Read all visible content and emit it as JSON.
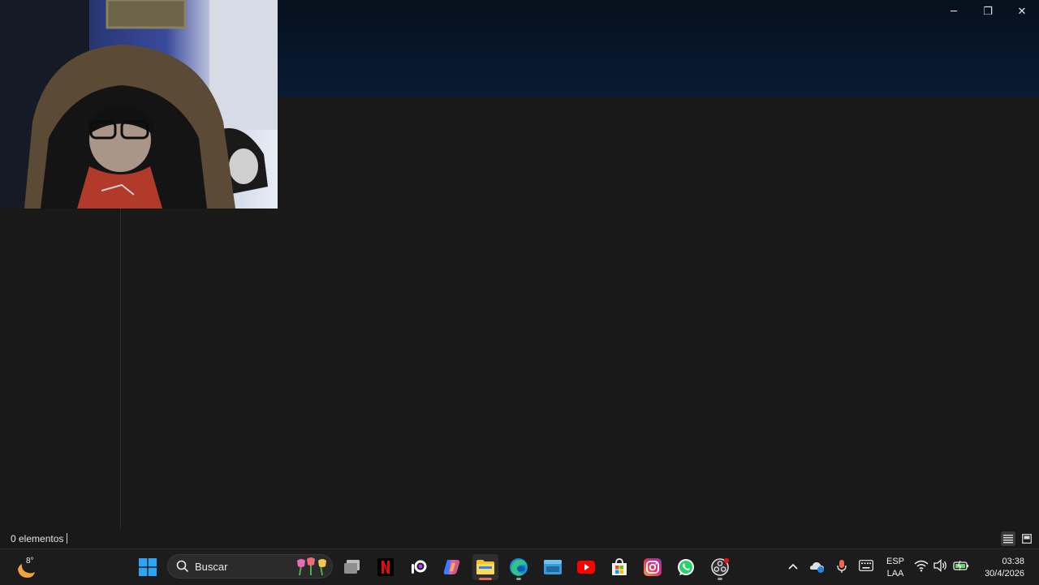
{
  "window": {
    "controls": {
      "minimize": "─",
      "maximize": "❐",
      "close": "✕"
    }
  },
  "statusbar": {
    "item_count": "0 elementos"
  },
  "taskbar": {
    "weather": {
      "temperature": "8°",
      "icon": "moon-weather-icon"
    },
    "search": {
      "label": "Buscar"
    },
    "apps": [
      {
        "name": "start-button",
        "icon": "windows-logo-icon"
      },
      {
        "name": "task-view",
        "icon": "task-view-icon"
      },
      {
        "name": "netflix",
        "icon": "netflix-icon"
      },
      {
        "name": "picsart",
        "icon": "picsart-icon"
      },
      {
        "name": "copilot",
        "icon": "copilot-icon"
      },
      {
        "name": "file-explorer",
        "icon": "folder-icon"
      },
      {
        "name": "edge",
        "icon": "edge-icon"
      },
      {
        "name": "remote-app",
        "icon": "window-app-icon"
      },
      {
        "name": "youtube",
        "icon": "youtube-icon"
      },
      {
        "name": "microsoft-store",
        "icon": "store-icon"
      },
      {
        "name": "instagram",
        "icon": "instagram-icon"
      },
      {
        "name": "whatsapp",
        "icon": "whatsapp-icon"
      },
      {
        "name": "obs",
        "icon": "obs-icon"
      }
    ],
    "tray": {
      "language": "ESP",
      "layout": "LAA",
      "time": "03:38",
      "date": "30/4/2026"
    }
  },
  "colors": {
    "titlebar": "#07162a",
    "content_bg": "#191919",
    "taskbar_bg": "#1c1c1c",
    "accent": "#e36a4f"
  }
}
